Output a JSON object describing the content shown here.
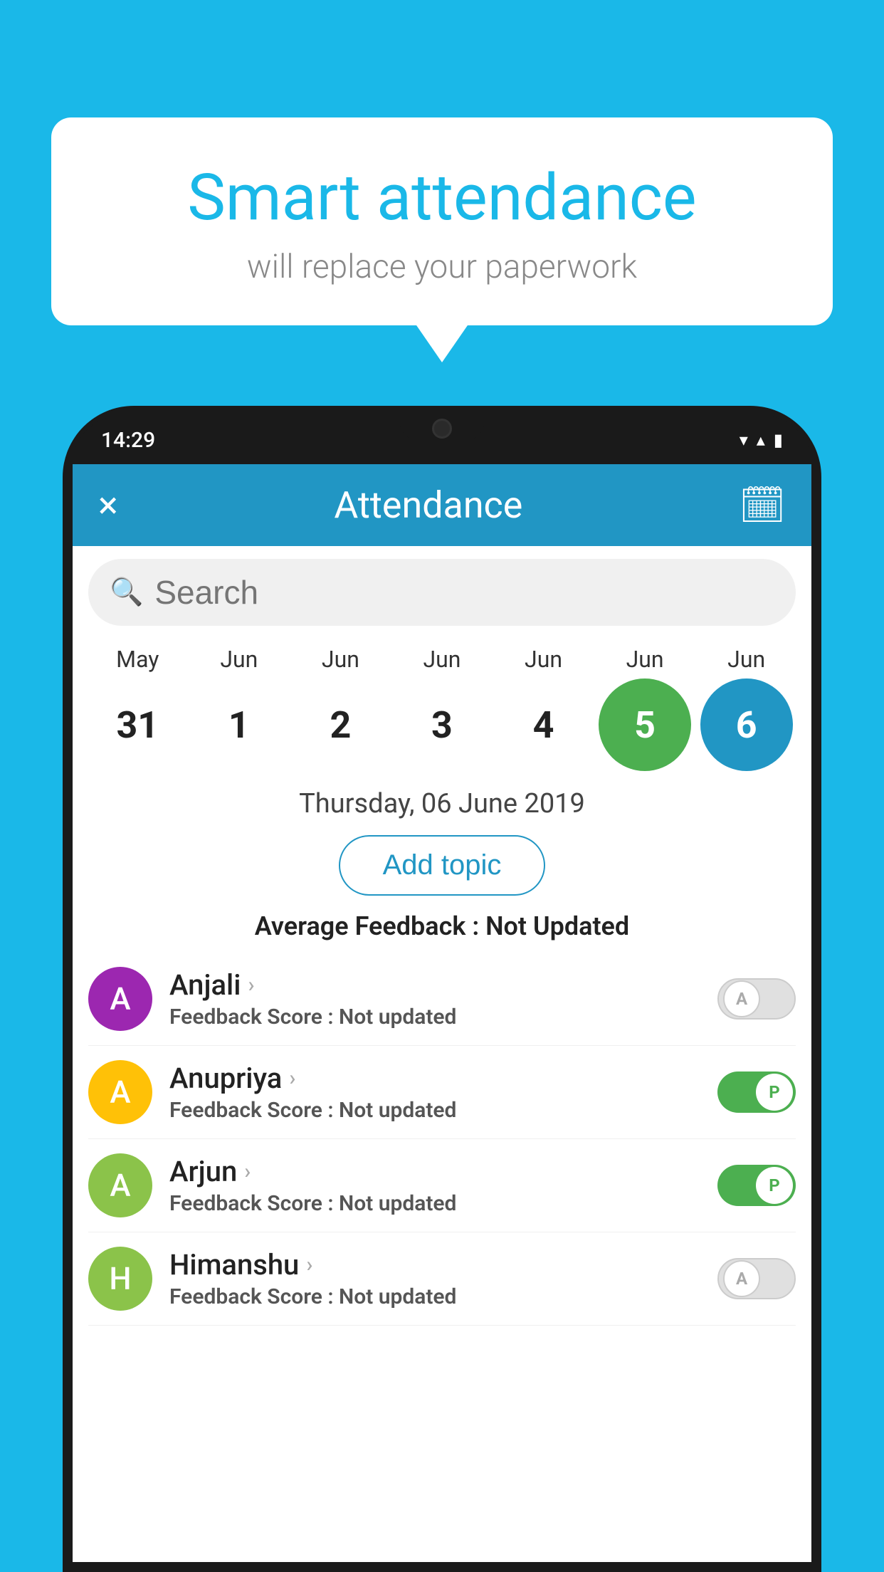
{
  "background_color": "#1ab8e8",
  "speech_bubble": {
    "title": "Smart attendance",
    "subtitle": "will replace your paperwork"
  },
  "phone": {
    "status_bar": {
      "time": "14:29"
    },
    "app_bar": {
      "title": "Attendance",
      "close_label": "×",
      "calendar_icon": "📅"
    },
    "search": {
      "placeholder": "Search"
    },
    "calendar": {
      "months": [
        "May",
        "Jun",
        "Jun",
        "Jun",
        "Jun",
        "Jun",
        "Jun"
      ],
      "days": [
        "31",
        "1",
        "2",
        "3",
        "4",
        "5",
        "6"
      ],
      "day_states": [
        "normal",
        "normal",
        "normal",
        "normal",
        "normal",
        "today",
        "selected"
      ]
    },
    "selected_date": "Thursday, 06 June 2019",
    "add_topic_label": "Add topic",
    "avg_feedback_label": "Average Feedback :",
    "avg_feedback_value": "Not Updated",
    "students": [
      {
        "name": "Anjali",
        "initial": "A",
        "avatar_color": "#9c27b0",
        "feedback_label": "Feedback Score :",
        "feedback_value": "Not updated",
        "toggle_state": "off",
        "toggle_letter": "A"
      },
      {
        "name": "Anupriya",
        "initial": "A",
        "avatar_color": "#ffc107",
        "feedback_label": "Feedback Score :",
        "feedback_value": "Not updated",
        "toggle_state": "on",
        "toggle_letter": "P"
      },
      {
        "name": "Arjun",
        "initial": "A",
        "avatar_color": "#8bc34a",
        "feedback_label": "Feedback Score :",
        "feedback_value": "Not updated",
        "toggle_state": "on",
        "toggle_letter": "P"
      },
      {
        "name": "Himanshu",
        "initial": "H",
        "avatar_color": "#8bc34a",
        "feedback_label": "Feedback Score :",
        "feedback_value": "Not updated",
        "toggle_state": "off",
        "toggle_letter": "A"
      }
    ]
  }
}
